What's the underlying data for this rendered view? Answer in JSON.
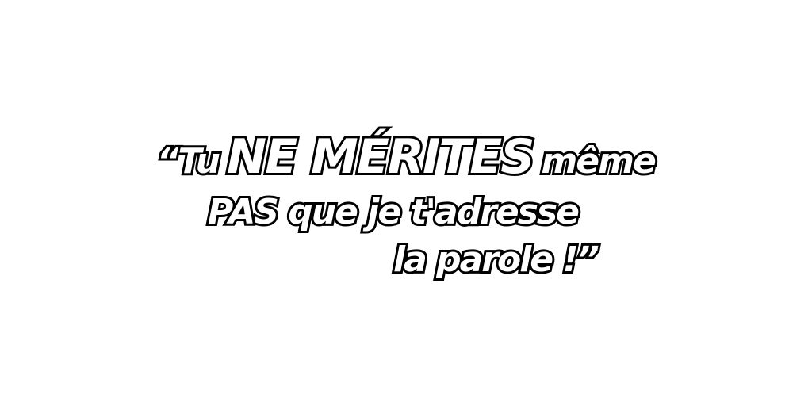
{
  "quote": {
    "open_mark": "“",
    "line1_a": "Tu",
    "line1_b": "NE MÉRITES",
    "line1_c": "même",
    "line2": "PAS que je t'adresse",
    "line3_text": "la parole !",
    "close_mark": "”"
  }
}
